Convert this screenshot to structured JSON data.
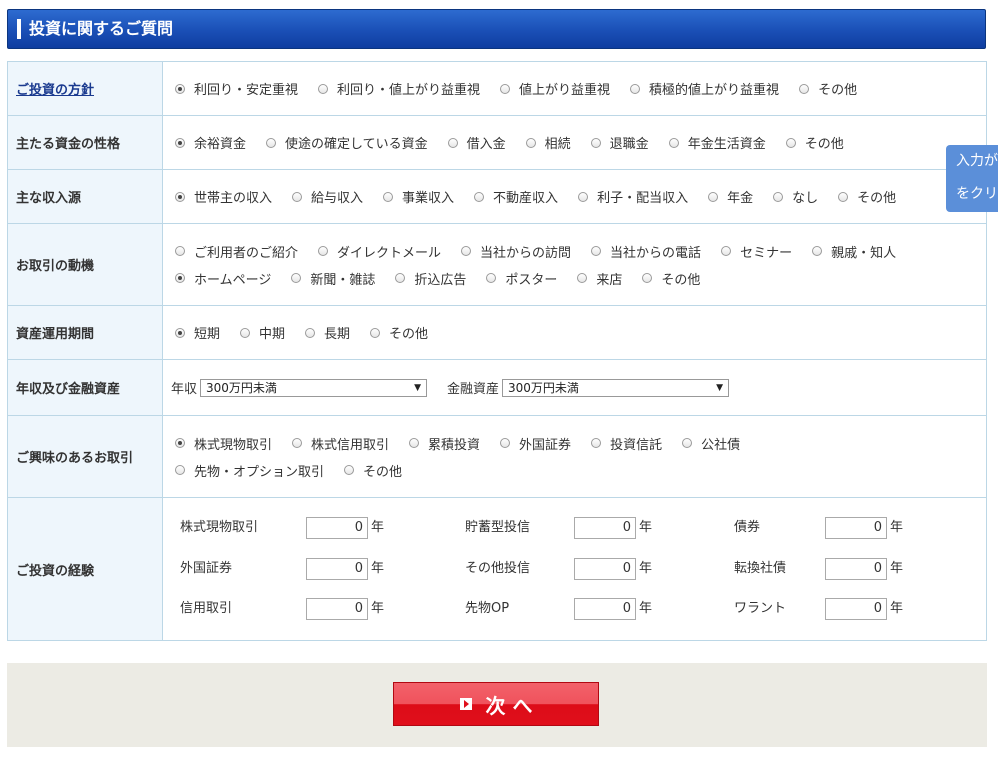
{
  "header": {
    "title": "投資に関するご質問"
  },
  "rows": {
    "policy": {
      "label": "ご投資の方針",
      "options": [
        "利回り・安定重視",
        "利回り・値上がり益重視",
        "値上がり益重視",
        "積極的値上がり益重視",
        "その他"
      ]
    },
    "fund": {
      "label": "主たる資金の性格",
      "options": [
        "余裕資金",
        "使途の確定している資金",
        "借入金",
        "相続",
        "退職金",
        "年金生活資金",
        "その他"
      ]
    },
    "income": {
      "label": "主な収入源",
      "options": [
        "世帯主の収入",
        "給与収入",
        "事業収入",
        "不動産収入",
        "利子・配当収入",
        "年金",
        "なし",
        "その他"
      ]
    },
    "motive": {
      "label": "お取引の動機",
      "line1": [
        "ご利用者のご紹介",
        "ダイレクトメール",
        "当社からの訪問",
        "当社からの電話",
        "セミナー",
        "親戚・知人"
      ],
      "line2": [
        "ホームページ",
        "新聞・雑誌",
        "折込広告",
        "ポスター",
        "来店",
        "その他"
      ]
    },
    "period": {
      "label": "資産運用期間",
      "options": [
        "短期",
        "中期",
        "長期",
        "その他"
      ]
    },
    "assets": {
      "label": "年収及び金融資産",
      "income_label": "年収",
      "income_value": "300万円未満",
      "assets_label": "金融資産",
      "assets_value": "300万円未満"
    },
    "interest": {
      "label": "ご興味のあるお取引",
      "line1": [
        "株式現物取引",
        "株式信用取引",
        "累積投資",
        "外国証券",
        "投資信託",
        "公社債"
      ],
      "line2": [
        "先物・オプション取引",
        "その他"
      ]
    },
    "experience": {
      "label": "ご投資の経験",
      "unit": "年",
      "items": [
        {
          "name": "株式現物取引",
          "value": "0"
        },
        {
          "name": "貯蓄型投信",
          "value": "0"
        },
        {
          "name": "債券",
          "value": "0"
        },
        {
          "name": "外国証券",
          "value": "0"
        },
        {
          "name": "その他投信",
          "value": "0"
        },
        {
          "name": "転換社債",
          "value": "0"
        },
        {
          "name": "信用取引",
          "value": "0"
        },
        {
          "name": "先物OP",
          "value": "0"
        },
        {
          "name": "ワラント",
          "value": "0"
        }
      ]
    }
  },
  "side_tab": {
    "line1": "入力が",
    "line2": "をクリッ"
  },
  "footer": {
    "next_label": "次 へ"
  }
}
